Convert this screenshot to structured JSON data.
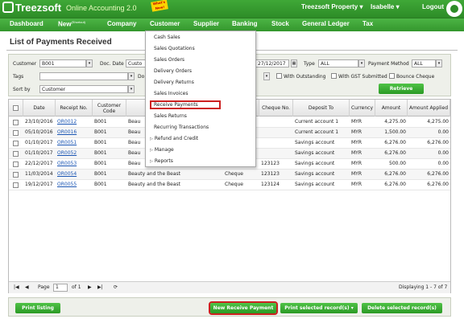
{
  "app": {
    "logo": "Treezsoft",
    "subtitle": "Online Accounting 2.0",
    "badge": "What's New!",
    "company": "Treezsoft Property",
    "user": "Isabelle",
    "logout": "Logout"
  },
  "nav": [
    "Dashboard",
    "New",
    "Company",
    "Customer",
    "Supplier",
    "Banking",
    "Stock",
    "General Ledger",
    "Tax"
  ],
  "nav_new_sup": "(Shortcut)",
  "page_title": "List of Payments Received",
  "filter": {
    "customer_label": "Customer",
    "customer_value": "B001",
    "doc_date_label": "Doc. Date",
    "doc_date_value": "Custo",
    "date_to": "27/12/2017",
    "type_label": "Type",
    "type_value": "ALL",
    "payment_method_label": "Payment Method",
    "payment_method_value": "ALL",
    "tags_label": "Tags",
    "do_label": "Do",
    "with_outstanding": "With Outstanding",
    "with_gst": "With GST Submitted",
    "bounce": "Bounce Cheque",
    "sort_label": "Sort by",
    "sort_value": "Customer",
    "retrieve": "Retrieve"
  },
  "table": {
    "headers": [
      "Date",
      "Receipt No.",
      "Customer Code",
      "Cheque No.",
      "Deposit To",
      "Currency",
      "Amount",
      "Amount Applied"
    ],
    "rows": [
      {
        "date": "23/10/2016",
        "receipt": "OR0012",
        "code": "B001",
        "name": "Beau",
        "method": "",
        "cheque": "",
        "deposit": "Current account 1",
        "currency": "MYR",
        "amount": "4,275.00",
        "applied": "4,275.00"
      },
      {
        "date": "05/10/2016",
        "receipt": "OR0016",
        "code": "B001",
        "name": "Beau",
        "method": "",
        "cheque": "",
        "deposit": "Current account 1",
        "currency": "MYR",
        "amount": "1,500.00",
        "applied": "0.00"
      },
      {
        "date": "01/10/2017",
        "receipt": "OR0051",
        "code": "B001",
        "name": "Beau",
        "method": "",
        "cheque": "",
        "deposit": "Savings account",
        "currency": "MYR",
        "amount": "6,276.00",
        "applied": "6,276.00"
      },
      {
        "date": "01/10/2017",
        "receipt": "OR0052",
        "code": "B001",
        "name": "Beau",
        "method": "",
        "cheque": "",
        "deposit": "Savings account",
        "currency": "MYR",
        "amount": "6,276.00",
        "applied": "0.00"
      },
      {
        "date": "22/12/2017",
        "receipt": "OR0053",
        "code": "B001",
        "name": "Beau",
        "method": "",
        "cheque": "123123",
        "deposit": "Savings account",
        "currency": "MYR",
        "amount": "500.00",
        "applied": "0.00"
      },
      {
        "date": "11/03/2014",
        "receipt": "OR0054",
        "code": "B001",
        "name": "Beauty and the Beast",
        "method": "Cheque",
        "cheque": "123123",
        "deposit": "Savings account",
        "currency": "MYR",
        "amount": "6,276.00",
        "applied": "6,276.00"
      },
      {
        "date": "19/12/2017",
        "receipt": "OR0055",
        "code": "B001",
        "name": "Beauty and the Beast",
        "method": "Cheque",
        "cheque": "123124",
        "deposit": "Savings account",
        "currency": "MYR",
        "amount": "6,276.00",
        "applied": "6,276.00"
      }
    ]
  },
  "pager": {
    "page_label": "Page",
    "page": "1",
    "of": "of 1",
    "display": "Displaying 1 - 7 of 7"
  },
  "buttons": {
    "print_listing": "Print listing",
    "new_receive": "New Receive Payment",
    "print_selected": "Print selected record(s)",
    "delete_selected": "Delete selected record(s)"
  },
  "menu": {
    "items": [
      "Cash Sales",
      "Sales Quotations",
      "Sales Orders",
      "Delivery Orders",
      "Delivery Returns",
      "Sales Invoices",
      "Receive Payments",
      "Sales Returns",
      "Recurring Transactions",
      "Refund and Credit",
      "Manage",
      "Reports"
    ]
  },
  "colors": {
    "brand_green": "#2d8c27",
    "highlight_red": "#cc1f1f",
    "link_blue": "#1a55b3"
  }
}
